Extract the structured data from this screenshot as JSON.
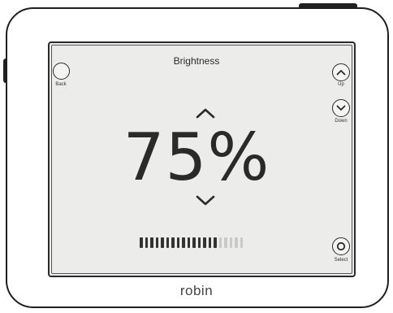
{
  "screen": {
    "title": "Brightness",
    "value": "75%",
    "level_percent": 75,
    "segments_total": 20,
    "segments_on": 15
  },
  "buttons": {
    "back": {
      "label": "Back",
      "icon": "back-circle-icon"
    },
    "up": {
      "label": "Up",
      "icon": "chevron-up-icon"
    },
    "down": {
      "label": "Down",
      "icon": "chevron-down-icon"
    },
    "select": {
      "label": "Select",
      "icon": "select-ring-icon"
    }
  },
  "brand": "robin",
  "colors": {
    "screen_bg": "#ececea",
    "text": "#2a2a2a",
    "segment_on": "#333333",
    "segment_off": "#c9c9c9"
  }
}
